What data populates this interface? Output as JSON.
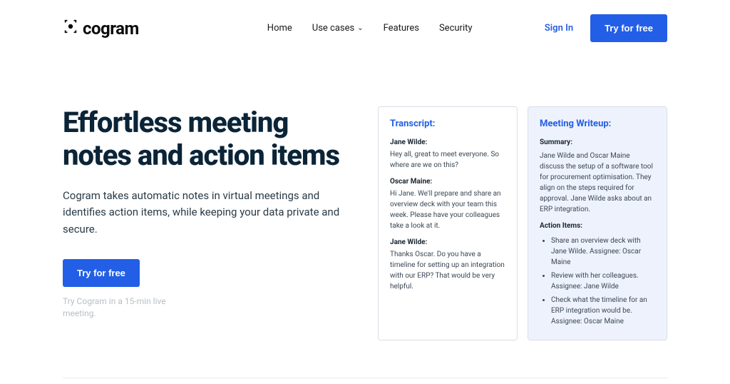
{
  "brand": {
    "name": "cogram"
  },
  "nav": {
    "items": [
      {
        "label": "Home"
      },
      {
        "label": "Use cases",
        "hasDropdown": true
      },
      {
        "label": "Features"
      },
      {
        "label": "Security"
      }
    ]
  },
  "auth": {
    "signIn": "Sign In",
    "tryFree": "Try for free"
  },
  "hero": {
    "title": "Effortless meeting notes and action items",
    "subtitle": "Cogram takes automatic notes in virtual meetings and identifies action items, while keeping your data private and secure.",
    "cta": "Try for free",
    "note": "Try Cogram in a 15-min live meeting."
  },
  "transcript": {
    "title": "Transcript:",
    "entries": [
      {
        "speaker": "Jane Wilde:",
        "text": "Hey all, great to meet everyone. So where are we on this?"
      },
      {
        "speaker": "Oscar Maine:",
        "text": "Hi Jane. We'll prepare and share an overview deck with your team this week. Please have your colleagues take a look at it."
      },
      {
        "speaker": "Jane Wilde:",
        "text": "Thanks Oscar. Do you have a timeline for setting up an integration with our ERP? That would be very helpful."
      }
    ]
  },
  "writeup": {
    "title": "Meeting Writeup:",
    "summaryLabel": "Summary:",
    "summary": "Jane Wilde and Oscar Maine discuss the setup of a software tool for procurement optimisation. They align on the steps required for approval. Jane Wilde asks about an ERP integration.",
    "actionLabel": "Action Items:",
    "actions": [
      "Share an overview deck with Jane Wilde. Assignee: Oscar Maine",
      "Review with her colleagues. Assignee: Jane Wilde",
      "Check what the timeline for an ERP integration would be. Assignee: Oscar Maine"
    ]
  }
}
